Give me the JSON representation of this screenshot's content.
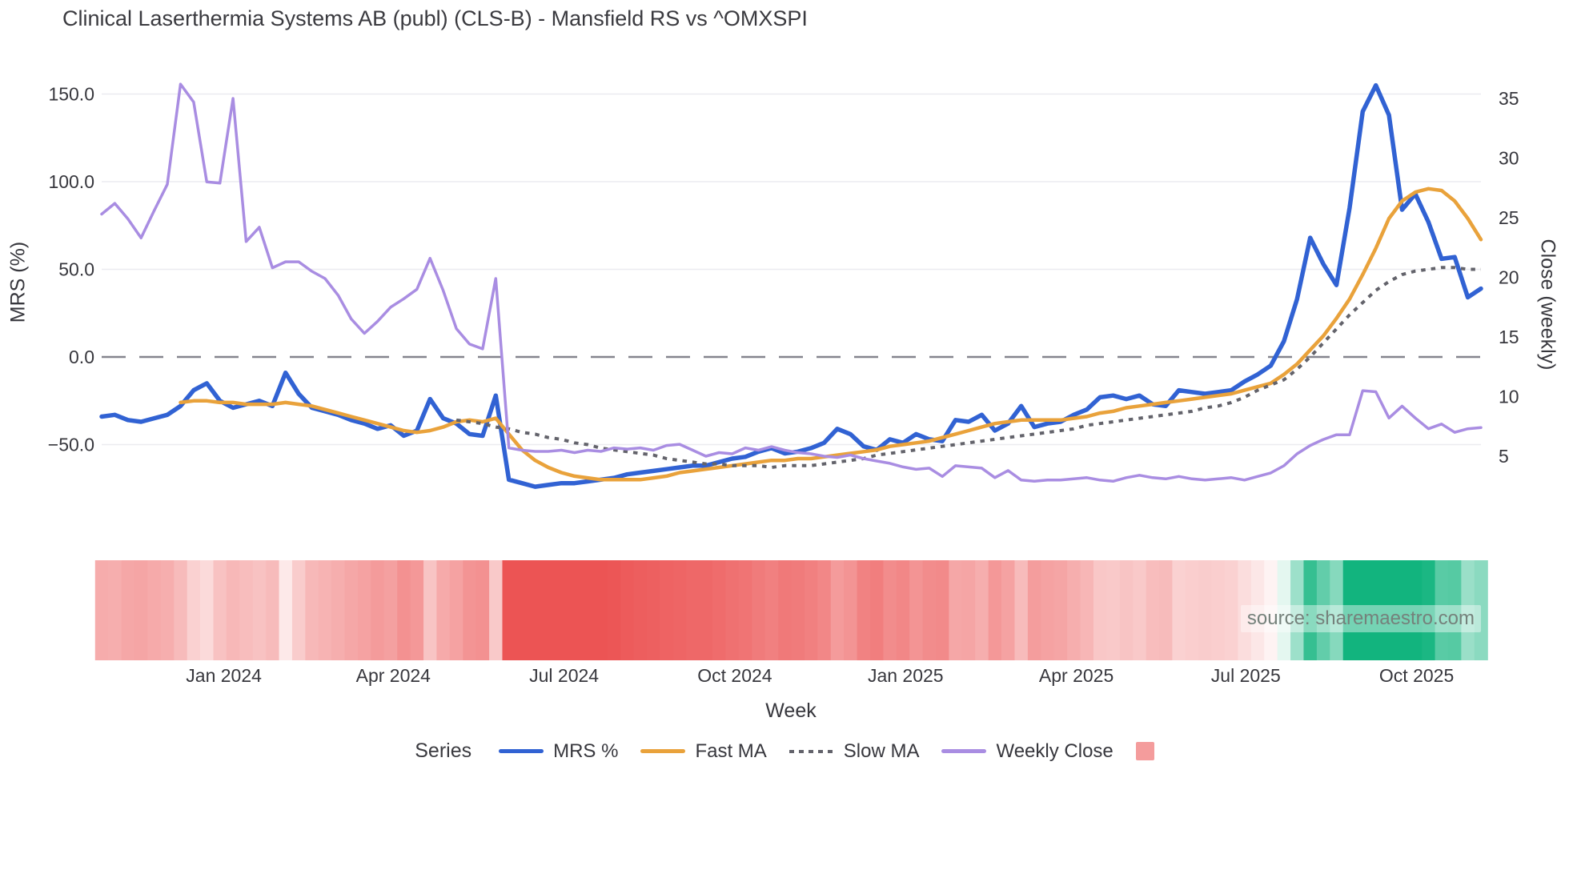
{
  "title": "Clinical Laserthermia Systems AB (publ) (CLS-B) - Mansfield RS vs ^OMXSPI",
  "source": "source: sharemaestro.com",
  "axes": {
    "left": {
      "title": "MRS (%)",
      "tick_labels": [
        "150.0",
        "100.0",
        "50.0",
        "0.0",
        "−50.0"
      ],
      "tick_values": [
        150,
        100,
        50,
        0,
        -50
      ]
    },
    "right": {
      "title": "Close (weekly)",
      "tick_labels": [
        "35",
        "30",
        "25",
        "20",
        "15",
        "10",
        "5"
      ],
      "tick_values": [
        35,
        30,
        25,
        20,
        15,
        10,
        5
      ]
    },
    "x": {
      "title": "Week"
    }
  },
  "legend": {
    "title": "Series",
    "items": [
      {
        "label": "MRS %",
        "style": "line",
        "color": "#3162d3"
      },
      {
        "label": "Fast MA",
        "style": "line",
        "color": "#e9a23b"
      },
      {
        "label": "Slow MA",
        "style": "dotted",
        "color": "#63636b"
      },
      {
        "label": "Weekly Close",
        "style": "line",
        "color": "#a98de2"
      },
      {
        "label": "",
        "style": "square",
        "color": "#f49c9c"
      }
    ]
  },
  "colors": {
    "mrs_blue": "#3162d3",
    "fast_orange": "#e9a23b",
    "slow_gray": "#63636b",
    "close_purple": "#a98de2",
    "zero_dash": "#84848e",
    "gridline": "#ebebf0",
    "heat_negative": "#ec5454",
    "heat_positive": "#12b47e",
    "heat_zero": "#ffffff",
    "legend_square": "#f49c9c",
    "text": "#37373d"
  },
  "chart_data": {
    "type": "line",
    "title": "Clinical Laserthermia Systems AB (publ) (CLS-B) - Mansfield RS vs ^OMXSPI",
    "xlabel": "Week",
    "ylabel_left": "MRS (%)",
    "ylabel_right": "Close (weekly)",
    "x_unit": "weekly samples, index 0-105 (Nov 2023 - Nov 2025)",
    "left_ylim": [
      -85,
      170
    ],
    "right_ylim": [
      2.4,
      37.7
    ],
    "grid": "horizontal-only",
    "zero_line": {
      "value": 0,
      "axis": "left",
      "style": "dashed"
    },
    "legend_position": "bottom-center",
    "x_ticks": [
      {
        "label": "Jan 2024",
        "week": 9.3
      },
      {
        "label": "Apr 2024",
        "week": 22.2
      },
      {
        "label": "Jul 2024",
        "week": 35.2
      },
      {
        "label": "Oct 2024",
        "week": 48.2
      },
      {
        "label": "Jan 2025",
        "week": 61.2
      },
      {
        "label": "Apr 2025",
        "week": 74.2
      },
      {
        "label": "Jul 2025",
        "week": 87.1
      },
      {
        "label": "Oct 2025",
        "week": 100.1
      }
    ],
    "series": [
      {
        "name": "MRS %",
        "axis": "left",
        "style": "solid",
        "width": 5.5,
        "color": "#3162d3",
        "values": [
          -34,
          -33,
          -36,
          -37,
          -35,
          -33,
          -28,
          -19,
          -15,
          -25,
          -29,
          -27,
          -25,
          -28,
          -9,
          -21,
          -29,
          -31,
          -33,
          -36,
          -38,
          -41,
          -39,
          -45,
          -42,
          -24,
          -35,
          -38,
          -44,
          -45,
          -22,
          -70,
          -72,
          -74,
          -73,
          -72,
          -72,
          -71,
          -70,
          -69,
          -67,
          -66,
          -65,
          -64,
          -63,
          -62,
          -62,
          -60,
          -58,
          -57,
          -54,
          -52,
          -55,
          -54,
          -52,
          -49,
          -41,
          -44,
          -51,
          -53,
          -47,
          -49,
          -44,
          -47,
          -48,
          -36,
          -37,
          -33,
          -42,
          -38,
          -28,
          -40,
          -38,
          -37,
          -33,
          -30,
          -23,
          -22,
          -24,
          -22,
          -27,
          -28,
          -19,
          -20,
          -21,
          -20,
          -19,
          -14,
          -10,
          -5,
          9,
          33,
          68,
          53,
          41,
          85,
          140,
          155,
          138,
          84,
          93,
          77,
          56,
          57,
          34,
          39
        ]
      },
      {
        "name": "Fast MA",
        "axis": "left",
        "style": "solid",
        "width": 4.5,
        "color": "#e9a23b",
        "values": [
          null,
          null,
          null,
          null,
          null,
          null,
          -26,
          -25,
          -25,
          -26,
          -26,
          -27,
          -27,
          -27,
          -26,
          -27,
          -28,
          -30,
          -32,
          -34,
          -36,
          -38,
          -40,
          -42,
          -43,
          -42,
          -40,
          -37,
          -36,
          -37,
          -35,
          -44,
          -53,
          -59,
          -63,
          -66,
          -68,
          -69,
          -70,
          -70,
          -70,
          -70,
          -69,
          -68,
          -66,
          -65,
          -64,
          -63,
          -62,
          -61,
          -60,
          -59,
          -59,
          -58,
          -58,
          -57,
          -56,
          -55,
          -54,
          -53,
          -51,
          -50,
          -49,
          -48,
          -46,
          -44,
          -42,
          -40,
          -38,
          -37,
          -36,
          -36,
          -36,
          -36,
          -35,
          -34,
          -32,
          -31,
          -29,
          -28,
          -27,
          -26,
          -25,
          -24,
          -23,
          -22,
          -21,
          -19,
          -17,
          -15,
          -10,
          -4,
          4,
          12,
          22,
          33,
          47,
          62,
          79,
          89,
          94,
          96,
          95,
          89,
          79,
          67
        ]
      },
      {
        "name": "Slow MA",
        "axis": "left",
        "style": "dotted",
        "width": 4,
        "color": "#63636b",
        "values": [
          null,
          null,
          null,
          null,
          null,
          null,
          null,
          null,
          null,
          null,
          null,
          null,
          null,
          null,
          null,
          null,
          null,
          null,
          null,
          null,
          null,
          null,
          null,
          null,
          null,
          null,
          null,
          -36,
          -37,
          -38,
          -40,
          -41,
          -43,
          -44,
          -46,
          -47,
          -49,
          -50,
          -52,
          -53,
          -54,
          -55,
          -56,
          -58,
          -59,
          -60,
          -61,
          -61,
          -62,
          -62,
          -62,
          -63,
          -62,
          -62,
          -62,
          -61,
          -60,
          -59,
          -58,
          -56,
          -55,
          -54,
          -53,
          -52,
          -51,
          -50,
          -49,
          -48,
          -47,
          -46,
          -45,
          -44,
          -43,
          -42,
          -41,
          -39,
          -38,
          -37,
          -36,
          -35,
          -34,
          -33,
          -32,
          -31,
          -29,
          -28,
          -26,
          -23,
          -19,
          -16,
          -13,
          -7,
          0,
          8,
          16,
          24,
          31,
          38,
          43,
          47,
          49,
          50,
          51,
          51,
          50,
          50
        ]
      },
      {
        "name": "Weekly Close",
        "axis": "right",
        "style": "solid",
        "width": 3.5,
        "color": "#a98de2",
        "values": [
          25.3,
          26.2,
          24.9,
          23.3,
          25.6,
          27.8,
          36.2,
          34.7,
          28.0,
          27.9,
          35.0,
          23.0,
          24.2,
          20.8,
          21.3,
          21.3,
          20.5,
          19.9,
          18.5,
          16.5,
          15.3,
          16.3,
          17.5,
          18.2,
          19.0,
          21.6,
          18.9,
          15.7,
          14.4,
          14.0,
          19.9,
          5.7,
          5.5,
          5.4,
          5.4,
          5.5,
          5.3,
          5.5,
          5.4,
          5.7,
          5.6,
          5.7,
          5.5,
          5.9,
          6.0,
          5.5,
          5.0,
          5.3,
          5.2,
          5.7,
          5.5,
          5.8,
          5.5,
          5.3,
          5.2,
          5.0,
          4.9,
          5.1,
          4.8,
          4.6,
          4.4,
          4.1,
          3.9,
          4.0,
          3.3,
          4.2,
          4.1,
          4.0,
          3.2,
          3.8,
          3.0,
          2.9,
          3.0,
          3.0,
          3.1,
          3.2,
          3.0,
          2.9,
          3.2,
          3.4,
          3.2,
          3.1,
          3.3,
          3.1,
          3.0,
          3.1,
          3.2,
          3.0,
          3.3,
          3.6,
          4.2,
          5.2,
          5.9,
          6.4,
          6.8,
          6.8,
          10.5,
          10.4,
          8.2,
          9.2,
          8.2,
          7.3,
          7.7,
          7.0,
          7.3,
          7.4
        ]
      }
    ],
    "heatmap_strip": {
      "description": "one cell per week colored by MRS % value",
      "source_series": "MRS %",
      "negative_saturation_at": -70,
      "positive_saturation_at": 80,
      "negative_color": "#ec5454",
      "positive_color": "#12b47e",
      "zero_color": "#ffffff"
    }
  }
}
